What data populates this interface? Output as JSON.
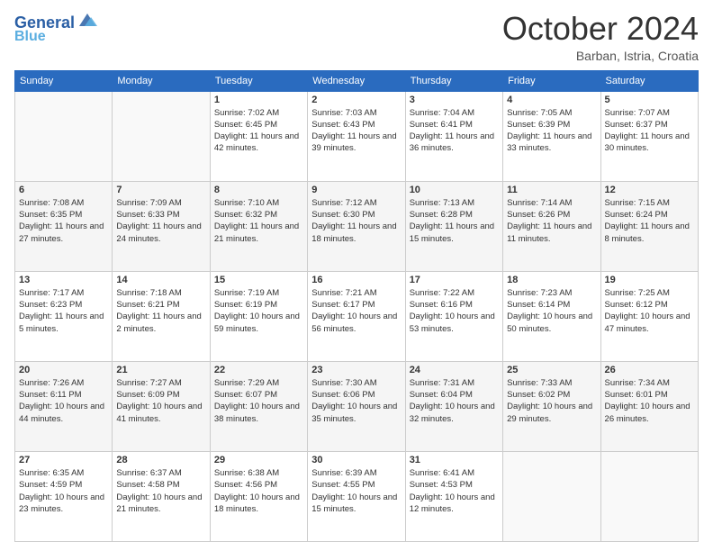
{
  "header": {
    "logo_line1": "General",
    "logo_line2": "Blue",
    "month": "October 2024",
    "location": "Barban, Istria, Croatia"
  },
  "days_of_week": [
    "Sunday",
    "Monday",
    "Tuesday",
    "Wednesday",
    "Thursday",
    "Friday",
    "Saturday"
  ],
  "weeks": [
    [
      {
        "day": "",
        "sunrise": "",
        "sunset": "",
        "daylight": ""
      },
      {
        "day": "",
        "sunrise": "",
        "sunset": "",
        "daylight": ""
      },
      {
        "day": "1",
        "sunrise": "Sunrise: 7:02 AM",
        "sunset": "Sunset: 6:45 PM",
        "daylight": "Daylight: 11 hours and 42 minutes."
      },
      {
        "day": "2",
        "sunrise": "Sunrise: 7:03 AM",
        "sunset": "Sunset: 6:43 PM",
        "daylight": "Daylight: 11 hours and 39 minutes."
      },
      {
        "day": "3",
        "sunrise": "Sunrise: 7:04 AM",
        "sunset": "Sunset: 6:41 PM",
        "daylight": "Daylight: 11 hours and 36 minutes."
      },
      {
        "day": "4",
        "sunrise": "Sunrise: 7:05 AM",
        "sunset": "Sunset: 6:39 PM",
        "daylight": "Daylight: 11 hours and 33 minutes."
      },
      {
        "day": "5",
        "sunrise": "Sunrise: 7:07 AM",
        "sunset": "Sunset: 6:37 PM",
        "daylight": "Daylight: 11 hours and 30 minutes."
      }
    ],
    [
      {
        "day": "6",
        "sunrise": "Sunrise: 7:08 AM",
        "sunset": "Sunset: 6:35 PM",
        "daylight": "Daylight: 11 hours and 27 minutes."
      },
      {
        "day": "7",
        "sunrise": "Sunrise: 7:09 AM",
        "sunset": "Sunset: 6:33 PM",
        "daylight": "Daylight: 11 hours and 24 minutes."
      },
      {
        "day": "8",
        "sunrise": "Sunrise: 7:10 AM",
        "sunset": "Sunset: 6:32 PM",
        "daylight": "Daylight: 11 hours and 21 minutes."
      },
      {
        "day": "9",
        "sunrise": "Sunrise: 7:12 AM",
        "sunset": "Sunset: 6:30 PM",
        "daylight": "Daylight: 11 hours and 18 minutes."
      },
      {
        "day": "10",
        "sunrise": "Sunrise: 7:13 AM",
        "sunset": "Sunset: 6:28 PM",
        "daylight": "Daylight: 11 hours and 15 minutes."
      },
      {
        "day": "11",
        "sunrise": "Sunrise: 7:14 AM",
        "sunset": "Sunset: 6:26 PM",
        "daylight": "Daylight: 11 hours and 11 minutes."
      },
      {
        "day": "12",
        "sunrise": "Sunrise: 7:15 AM",
        "sunset": "Sunset: 6:24 PM",
        "daylight": "Daylight: 11 hours and 8 minutes."
      }
    ],
    [
      {
        "day": "13",
        "sunrise": "Sunrise: 7:17 AM",
        "sunset": "Sunset: 6:23 PM",
        "daylight": "Daylight: 11 hours and 5 minutes."
      },
      {
        "day": "14",
        "sunrise": "Sunrise: 7:18 AM",
        "sunset": "Sunset: 6:21 PM",
        "daylight": "Daylight: 11 hours and 2 minutes."
      },
      {
        "day": "15",
        "sunrise": "Sunrise: 7:19 AM",
        "sunset": "Sunset: 6:19 PM",
        "daylight": "Daylight: 10 hours and 59 minutes."
      },
      {
        "day": "16",
        "sunrise": "Sunrise: 7:21 AM",
        "sunset": "Sunset: 6:17 PM",
        "daylight": "Daylight: 10 hours and 56 minutes."
      },
      {
        "day": "17",
        "sunrise": "Sunrise: 7:22 AM",
        "sunset": "Sunset: 6:16 PM",
        "daylight": "Daylight: 10 hours and 53 minutes."
      },
      {
        "day": "18",
        "sunrise": "Sunrise: 7:23 AM",
        "sunset": "Sunset: 6:14 PM",
        "daylight": "Daylight: 10 hours and 50 minutes."
      },
      {
        "day": "19",
        "sunrise": "Sunrise: 7:25 AM",
        "sunset": "Sunset: 6:12 PM",
        "daylight": "Daylight: 10 hours and 47 minutes."
      }
    ],
    [
      {
        "day": "20",
        "sunrise": "Sunrise: 7:26 AM",
        "sunset": "Sunset: 6:11 PM",
        "daylight": "Daylight: 10 hours and 44 minutes."
      },
      {
        "day": "21",
        "sunrise": "Sunrise: 7:27 AM",
        "sunset": "Sunset: 6:09 PM",
        "daylight": "Daylight: 10 hours and 41 minutes."
      },
      {
        "day": "22",
        "sunrise": "Sunrise: 7:29 AM",
        "sunset": "Sunset: 6:07 PM",
        "daylight": "Daylight: 10 hours and 38 minutes."
      },
      {
        "day": "23",
        "sunrise": "Sunrise: 7:30 AM",
        "sunset": "Sunset: 6:06 PM",
        "daylight": "Daylight: 10 hours and 35 minutes."
      },
      {
        "day": "24",
        "sunrise": "Sunrise: 7:31 AM",
        "sunset": "Sunset: 6:04 PM",
        "daylight": "Daylight: 10 hours and 32 minutes."
      },
      {
        "day": "25",
        "sunrise": "Sunrise: 7:33 AM",
        "sunset": "Sunset: 6:02 PM",
        "daylight": "Daylight: 10 hours and 29 minutes."
      },
      {
        "day": "26",
        "sunrise": "Sunrise: 7:34 AM",
        "sunset": "Sunset: 6:01 PM",
        "daylight": "Daylight: 10 hours and 26 minutes."
      }
    ],
    [
      {
        "day": "27",
        "sunrise": "Sunrise: 6:35 AM",
        "sunset": "Sunset: 4:59 PM",
        "daylight": "Daylight: 10 hours and 23 minutes."
      },
      {
        "day": "28",
        "sunrise": "Sunrise: 6:37 AM",
        "sunset": "Sunset: 4:58 PM",
        "daylight": "Daylight: 10 hours and 21 minutes."
      },
      {
        "day": "29",
        "sunrise": "Sunrise: 6:38 AM",
        "sunset": "Sunset: 4:56 PM",
        "daylight": "Daylight: 10 hours and 18 minutes."
      },
      {
        "day": "30",
        "sunrise": "Sunrise: 6:39 AM",
        "sunset": "Sunset: 4:55 PM",
        "daylight": "Daylight: 10 hours and 15 minutes."
      },
      {
        "day": "31",
        "sunrise": "Sunrise: 6:41 AM",
        "sunset": "Sunset: 4:53 PM",
        "daylight": "Daylight: 10 hours and 12 minutes."
      },
      {
        "day": "",
        "sunrise": "",
        "sunset": "",
        "daylight": ""
      },
      {
        "day": "",
        "sunrise": "",
        "sunset": "",
        "daylight": ""
      }
    ]
  ]
}
